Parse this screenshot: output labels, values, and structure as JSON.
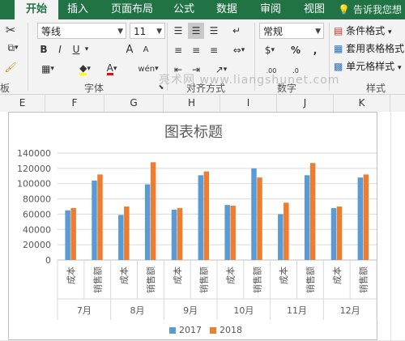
{
  "ribbon": {
    "tabs": [
      "开始",
      "插入",
      "页面布局",
      "公式",
      "数据",
      "审阅",
      "视图"
    ],
    "active_tab": "开始",
    "tell_me": "告诉我您想",
    "font_name": "等线",
    "font_size": "11",
    "bold": "B",
    "italic": "I",
    "underline": "U",
    "font_grow": "A",
    "font_shrink": "A",
    "font_color_letter": "A",
    "wen_char": "wén",
    "number_format": "常规",
    "percent": "%",
    "comma": ",",
    "currency": "$",
    "dec_increase": ".00",
    "dec_decrease": ".0",
    "cond_format": "条件格式",
    "table_format": "套用表格格式",
    "cell_style": "单元格样式",
    "group_clipboard": "板",
    "group_font": "字体",
    "group_align": "对齐方式",
    "group_number": "数字",
    "group_styles": "样式",
    "watermark": "亮术网 www.liangshunet.com"
  },
  "columns": [
    "E",
    "F",
    "G",
    "H",
    "I",
    "J",
    "K"
  ],
  "colors": {
    "s2017": "#5b9bd5",
    "s2018": "#ed7d31",
    "excel_green": "#217346"
  },
  "chart_data": {
    "type": "bar",
    "title": "图表标题",
    "groups": [
      "7月",
      "8月",
      "9月",
      "10月",
      "11月",
      "12月"
    ],
    "sub_categories": [
      "成本",
      "销售额"
    ],
    "series": [
      {
        "name": "2017",
        "values": [
          65000,
          104000,
          59000,
          99000,
          66000,
          111000,
          72000,
          120000,
          60000,
          111000,
          68000,
          108000
        ]
      },
      {
        "name": "2018",
        "values": [
          68000,
          112000,
          70000,
          128000,
          68000,
          116000,
          71000,
          108000,
          75000,
          127000,
          70000,
          112000
        ]
      }
    ],
    "ylim": [
      0,
      140000
    ],
    "y_ticks": [
      "0",
      "20000",
      "40000",
      "60000",
      "80000",
      "100000",
      "120000",
      "140000"
    ],
    "grid": true,
    "legend": "bottom"
  }
}
